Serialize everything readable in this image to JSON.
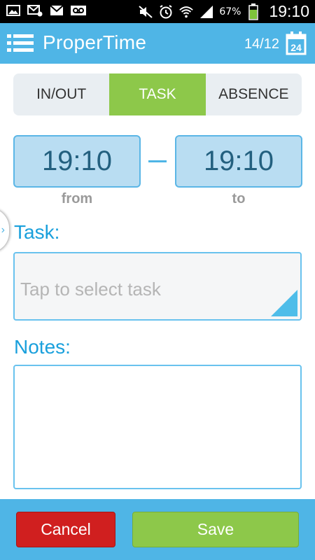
{
  "status_bar": {
    "left_icons": [
      "image-icon",
      "mail-badge-icon",
      "gmail-icon",
      "voicemail-icon"
    ],
    "right_icons": [
      "mute-icon",
      "alarm-icon",
      "wifi-icon",
      "signal-icon",
      "battery-icon"
    ],
    "battery_percent": "67%",
    "time": "19:10"
  },
  "action_bar": {
    "title": "ProperTime",
    "date": "14/12",
    "calendar_day": "24",
    "color": "#4fb5e6"
  },
  "segments": {
    "items": [
      "IN/OUT",
      "TASK",
      "ABSENCE"
    ],
    "selected": "TASK",
    "active_color": "#8dc84a"
  },
  "time": {
    "from_value": "19:10",
    "to_value": "19:10",
    "from_caption": "from",
    "to_caption": "to"
  },
  "task": {
    "label": "Task:",
    "placeholder": "Tap to select task"
  },
  "notes": {
    "label": "Notes:",
    "value": ""
  },
  "buttons": {
    "cancel": "Cancel",
    "save": "Save",
    "cancel_color": "#d01f1f",
    "save_color": "#8dc84a"
  }
}
